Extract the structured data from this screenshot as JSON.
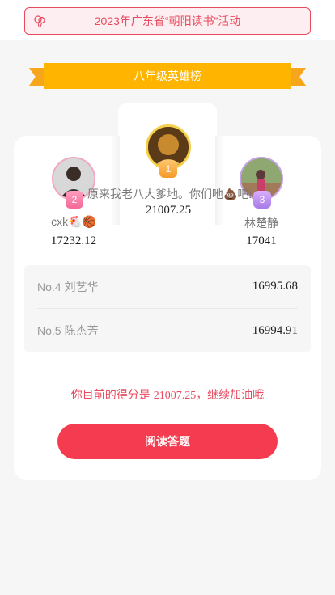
{
  "banner": {
    "text": "2023年广东省“朝阳读书”活动",
    "icon": "balloons-icon"
  },
  "ribbon": {
    "title": "八年级英雄榜"
  },
  "podium": {
    "first": {
      "rank": "1",
      "name": "原来我老八大爹地。你们吔💩吧!",
      "score": "21007.25"
    },
    "second": {
      "rank": "2",
      "name": "cxk🐔🏀",
      "score": "17232.12"
    },
    "third": {
      "rank": "3",
      "name": "林楚静",
      "score": "17041"
    }
  },
  "ranking": [
    {
      "rank": "No.4",
      "name": "刘艺华",
      "score": "16995.68"
    },
    {
      "rank": "No.5",
      "name": "陈杰芳",
      "score": "16994.91"
    }
  ],
  "my_score": {
    "prefix": "你目前的得分是 ",
    "value": "21007.25",
    "suffix": "，继续加油哦"
  },
  "action": {
    "label": "阅读答题"
  },
  "colors": {
    "accent": "#f43b4f",
    "gold": "#ffb400",
    "banner_border": "#e84a5f"
  }
}
